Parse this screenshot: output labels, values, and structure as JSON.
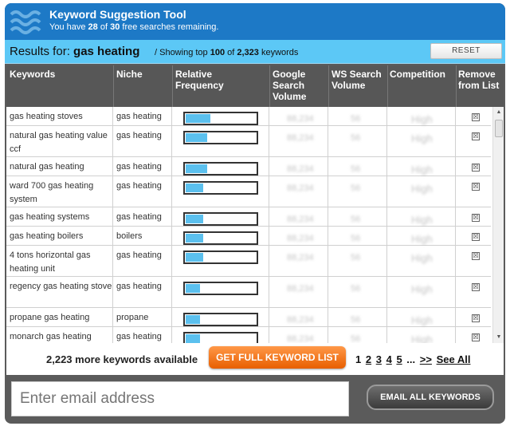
{
  "header": {
    "title": "Keyword Suggestion Tool",
    "sub_prefix": "You have ",
    "remaining": "28",
    "sub_mid": " of ",
    "total": "30",
    "sub_suffix": " free searches remaining."
  },
  "results": {
    "label": "Results for: ",
    "query": "gas heating",
    "showing_prefix": " / Showing top ",
    "top": "100",
    "showing_mid": " of ",
    "total": "2,323",
    "showing_suffix": " keywords",
    "reset_label": "RESET"
  },
  "columns": {
    "keywords": "Keywords",
    "niche": "Niche",
    "relative_frequency": "Relative Frequency",
    "google_search_volume": "Google Search Volume",
    "ws_search_volume": "WS Search Volume",
    "competition": "Competition",
    "remove": "Remove from List"
  },
  "rows": [
    {
      "keyword": "gas heating stoves",
      "niche": "gas heating",
      "frequency": 0.35,
      "google": "88,234",
      "ws": "56",
      "competition": "High"
    },
    {
      "keyword": "natural gas heating value ccf",
      "niche": "gas heating",
      "frequency": 0.31,
      "google": "88,234",
      "ws": "56",
      "competition": "High"
    },
    {
      "keyword": "natural gas heating",
      "niche": "gas heating",
      "frequency": 0.31,
      "google": "88,234",
      "ws": "56",
      "competition": "High"
    },
    {
      "keyword": "ward 700 gas heating system",
      "niche": "gas heating",
      "frequency": 0.25,
      "google": "88,234",
      "ws": "56",
      "competition": "High"
    },
    {
      "keyword": "gas heating systems",
      "niche": "gas heating",
      "frequency": 0.25,
      "google": "88,234",
      "ws": "56",
      "competition": "High"
    },
    {
      "keyword": "gas heating boilers",
      "niche": "boilers",
      "frequency": 0.25,
      "google": "88,234",
      "ws": "56",
      "competition": "High"
    },
    {
      "keyword": "4 tons horizontal gas heating unit",
      "niche": "gas heating",
      "frequency": 0.25,
      "google": "88,234",
      "ws": "56",
      "competition": "High"
    },
    {
      "keyword": "regency gas heating stove",
      "niche": "gas heating",
      "frequency": 0.2,
      "google": "88,234",
      "ws": "56",
      "competition": "High"
    },
    {
      "keyword": "propane gas heating",
      "niche": "propane",
      "frequency": 0.2,
      "google": "88,234",
      "ws": "56",
      "competition": "High"
    },
    {
      "keyword": "monarch gas heating",
      "niche": "gas heating",
      "frequency": 0.2,
      "google": "88,234",
      "ws": "56",
      "competition": "High"
    }
  ],
  "remove_glyph": "☒",
  "footer": {
    "more_text": "2,223 more keywords available",
    "get_full_label": "GET FULL KEYWORD LIST",
    "pages": [
      "1",
      "2",
      "3",
      "4",
      "5"
    ],
    "ellipsis": "...",
    "next": ">>",
    "see_all": "See All"
  },
  "email": {
    "placeholder": "Enter email address",
    "button_label": "EMAIL ALL KEYWORDS"
  },
  "colors": {
    "header_blue": "#1d79c6",
    "results_bar": "#5cc8f6",
    "frequency_fill": "#5bc0ee",
    "orange_button": "#ff8a2b",
    "frame": "#5b5b5b"
  }
}
